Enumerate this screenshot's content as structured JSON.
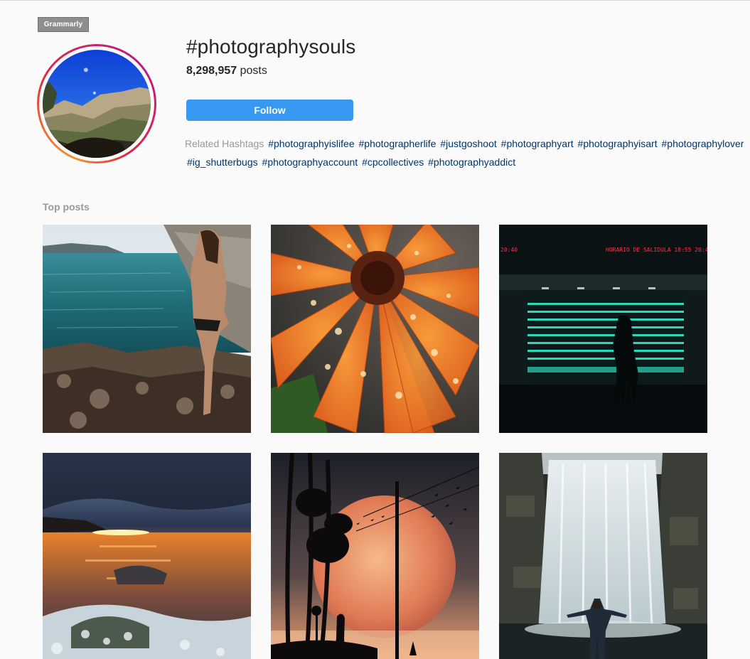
{
  "overlay": {
    "grammarly_label": "Grammarly"
  },
  "header": {
    "hashtag": "#photographysouls",
    "post_count": "8,298,957",
    "post_count_suffix": " posts",
    "follow_label": "Follow"
  },
  "related": {
    "label": "Related Hashtags",
    "tags": [
      "#photographyislifee",
      "#photographerlife",
      "#justgoshoot",
      "#photographyart",
      "#photographyisart",
      "#photographylover",
      "#ig_shutterbugs",
      "#photographyaccount",
      "#cpcollectives",
      "#photographyaddict"
    ]
  },
  "top_posts": {
    "title": "Top posts",
    "items": [
      {
        "subject": "woman-on-rocks-by-sea"
      },
      {
        "subject": "orange-flower-with-droplets"
      },
      {
        "subject": "silhouette-in-neon-station",
        "sign_text": "HORARIO DE SALIDULA  18:55  20:40",
        "sign_text_left": "20:40"
      },
      {
        "subject": "sunset-over-sea-rocks"
      },
      {
        "subject": "silhouette-under-giant-moon"
      },
      {
        "subject": "man-before-waterfall"
      }
    ]
  },
  "colors": {
    "follow_button": "#3897f0",
    "hashtag_link": "#003569",
    "muted_text": "#999999"
  }
}
